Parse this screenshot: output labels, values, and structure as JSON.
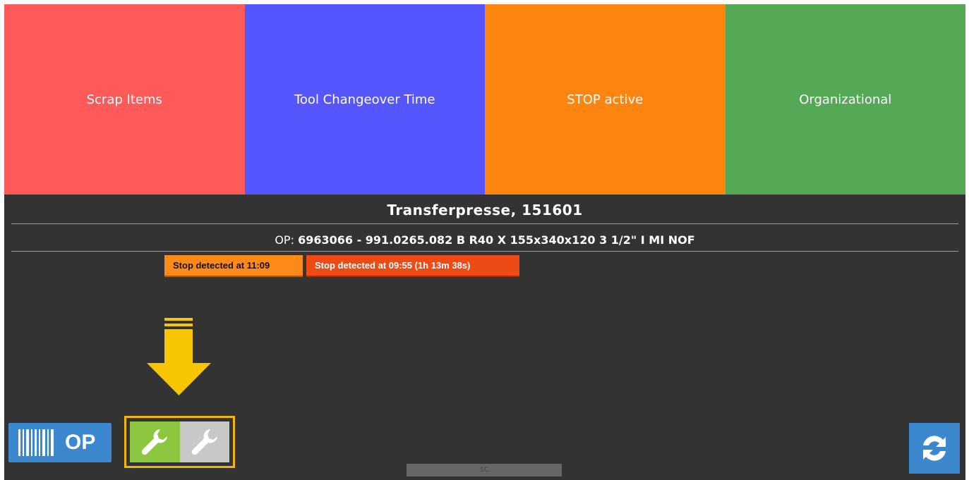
{
  "tiles": [
    {
      "label": "Scrap Items",
      "color": "#ff5a5a"
    },
    {
      "label": "Tool Changeover Time",
      "color": "#5656ff"
    },
    {
      "label": "STOP active",
      "color": "#ff8511"
    },
    {
      "label": "Organizational",
      "color": "#55a855"
    }
  ],
  "machine": {
    "title": "Transferpresse, 151601"
  },
  "op": {
    "label": "OP:",
    "value": "6963066 - 991.0265.082 B R40 X 155x340x120 3 1/2\" I MI NOF"
  },
  "stops": [
    {
      "text": "Stop detected at 11:09",
      "color": "#ff8a1a"
    },
    {
      "text": "Stop detected at 09:55 (1h 13m 38s)",
      "color": "#ee4a16"
    }
  ],
  "buttons": {
    "op_label": "OP",
    "barcode_icon": "barcode-icon",
    "tool_active_icon": "wrench-icon",
    "tool_inactive_icon": "wrench-icon",
    "refresh_icon": "refresh-arrows-icon"
  },
  "status_bar": {
    "text": "SC"
  },
  "colors": {
    "panel_bg": "#333333",
    "button_blue": "#3b88cf",
    "highlight": "#f2b705",
    "tool_active": "#8dc63f",
    "tool_inactive": "#c8c8c8"
  }
}
